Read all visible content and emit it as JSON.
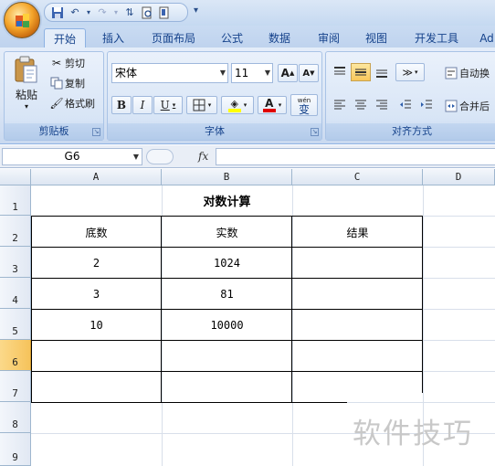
{
  "quick_access": {
    "more": "▾"
  },
  "tabs": [
    {
      "label": "开始",
      "active": true
    },
    {
      "label": "插入"
    },
    {
      "label": "页面布局"
    },
    {
      "label": "公式"
    },
    {
      "label": "数据"
    },
    {
      "label": "审阅"
    },
    {
      "label": "视图"
    },
    {
      "label": "开发工具"
    },
    {
      "label": "Ad"
    }
  ],
  "clipboard": {
    "paste": "粘贴",
    "cut": "剪切",
    "copy": "复制",
    "format_painter": "格式刷",
    "label": "剪贴板"
  },
  "font": {
    "name": "宋体",
    "size": "11",
    "bold": "B",
    "italic": "I",
    "underline": "U",
    "grow": "A",
    "shrink": "A",
    "label": "字体",
    "phonetic": "wén",
    "phonetic_char": "变"
  },
  "alignment": {
    "wrap_text": "自动换",
    "merge": "合并后",
    "label": "对齐方式"
  },
  "formula_bar": {
    "name_box": "G6",
    "fx": "fx",
    "value": ""
  },
  "columns": [
    "A",
    "B",
    "C",
    "D"
  ],
  "rows": [
    "1",
    "2",
    "3",
    "4",
    "5",
    "6",
    "7",
    "8",
    "9"
  ],
  "selected_row": "6",
  "sheet": {
    "title": "对数计算",
    "headers": [
      "底数",
      "实数",
      "结果"
    ],
    "data": [
      [
        "2",
        "1024",
        ""
      ],
      [
        "3",
        "81",
        ""
      ],
      [
        "10",
        "10000",
        ""
      ]
    ]
  },
  "watermark": "软件技巧",
  "colors": {
    "ribbon_bg": "#dbe6f5",
    "accent": "#15428b",
    "selected_row": "#f6c35b"
  }
}
